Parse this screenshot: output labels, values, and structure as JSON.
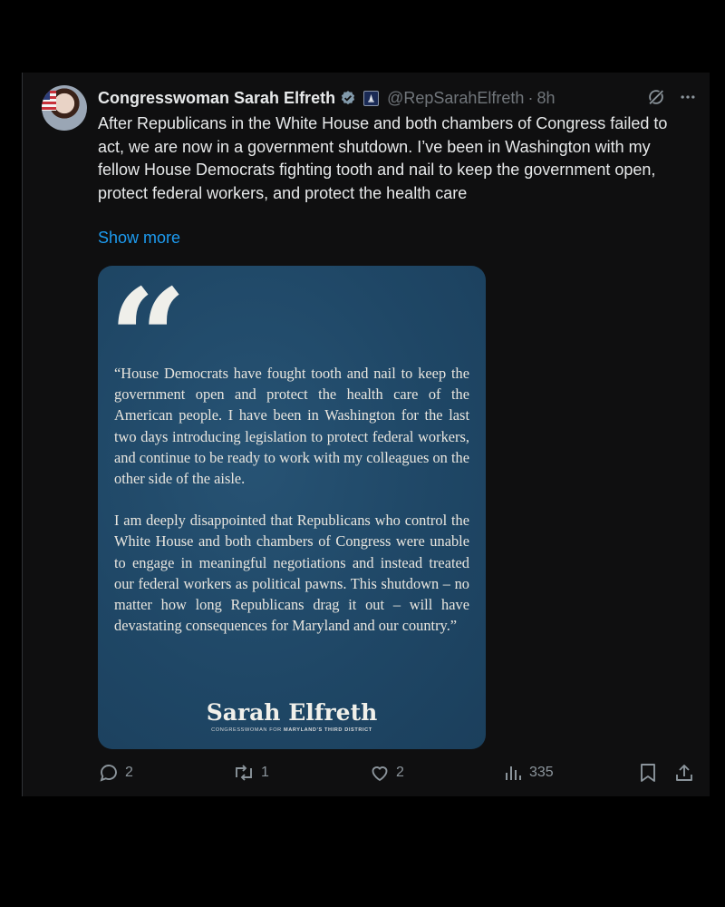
{
  "post": {
    "author_name": "Congresswoman Sarah Elfreth",
    "handle": "@RepSarahElfreth",
    "separator": "·",
    "time": "8h",
    "text": "After Republicans in the White House and both chambers of Congress failed to act, we are now in a government shutdown. I’ve been in Washington with my fellow House Democrats fighting tooth and nail to keep the government open, protect federal workers, and protect the health care",
    "show_more": "Show more"
  },
  "card": {
    "quote_mark": "“",
    "paragraph_1": "“House Democrats have fought tooth and nail to keep the government open and protect the health care of the American people. I have been in Washington for the last two days introducing legislation to protect federal workers, and continue to be ready to work with my colleagues on the other side of the aisle.",
    "paragraph_2": "I am deeply disappointed that Republicans who control the White House and both chambers of Congress were unable to engage in meaningful negotiations and instead treated our federal workers as political pawns. This shutdown – no matter how long Republicans drag it out – will have devastating consequences for Maryland and our country.”",
    "signature": "Sarah Elfreth",
    "subtitle_prefix": "CONGRESSWOMAN FOR",
    "subtitle_bold": "MARYLAND'S THIRD DISTRICT"
  },
  "actions": {
    "replies": "2",
    "reposts": "1",
    "likes": "2",
    "views": "335"
  },
  "icons": {
    "verified": "verified-badge-icon",
    "government": "government-badge-icon",
    "grok": "grok-icon",
    "more": "more-icon",
    "reply": "reply-icon",
    "repost": "repost-icon",
    "like": "heart-icon",
    "views": "views-chart-icon",
    "bookmark": "bookmark-icon",
    "share": "share-icon"
  },
  "colors": {
    "background": "#000000",
    "post_bg": "#0f0f10",
    "link": "#1d9bf0",
    "muted": "#71767b",
    "card_bg": "#1f4766"
  }
}
